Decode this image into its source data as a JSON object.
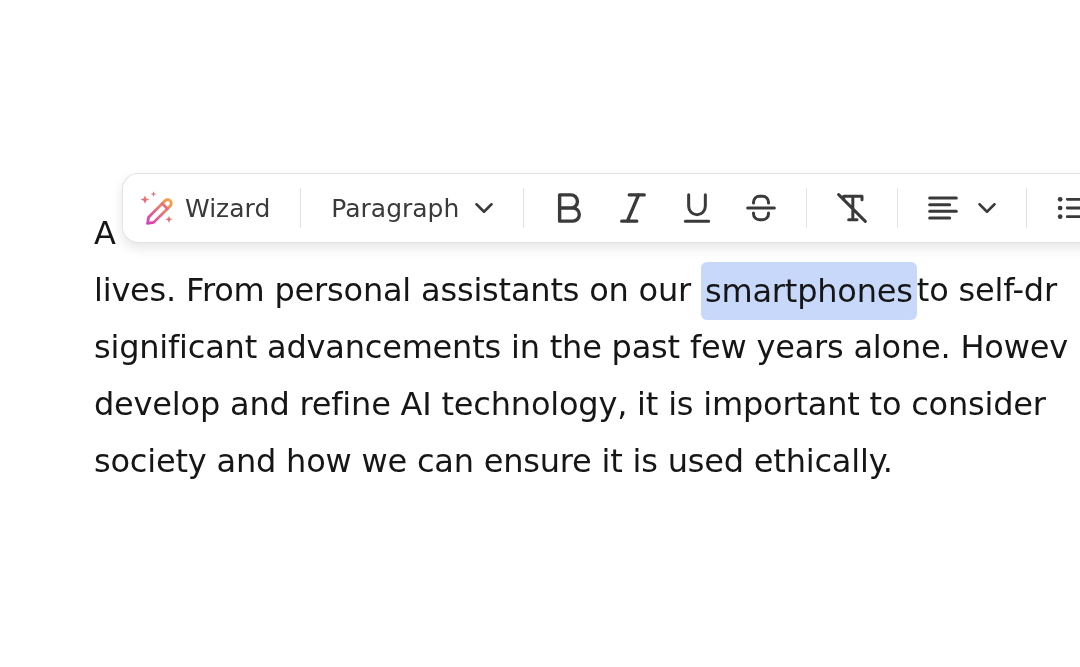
{
  "toolbar": {
    "wizard": {
      "label": "Wizard"
    },
    "block_format": {
      "value": "Paragraph"
    }
  },
  "document": {
    "lines": [
      {
        "segments": [
          {
            "text": "A",
            "selected": false
          }
        ]
      },
      {
        "segments": [
          {
            "text": "lives. From personal assistants on our ",
            "selected": false
          },
          {
            "text": "smartphones",
            "selected": true
          },
          {
            "text": "to self-dr",
            "selected": false
          }
        ]
      },
      {
        "segments": [
          {
            "text": "significant advancements in the past few years alone. Howev",
            "selected": false
          }
        ]
      },
      {
        "segments": [
          {
            "text": "develop and refine AI technology, it is important to consider",
            "selected": false
          }
        ]
      },
      {
        "segments": [
          {
            "text": "society and how we can ensure it is used ethically.",
            "selected": false
          }
        ]
      }
    ]
  }
}
